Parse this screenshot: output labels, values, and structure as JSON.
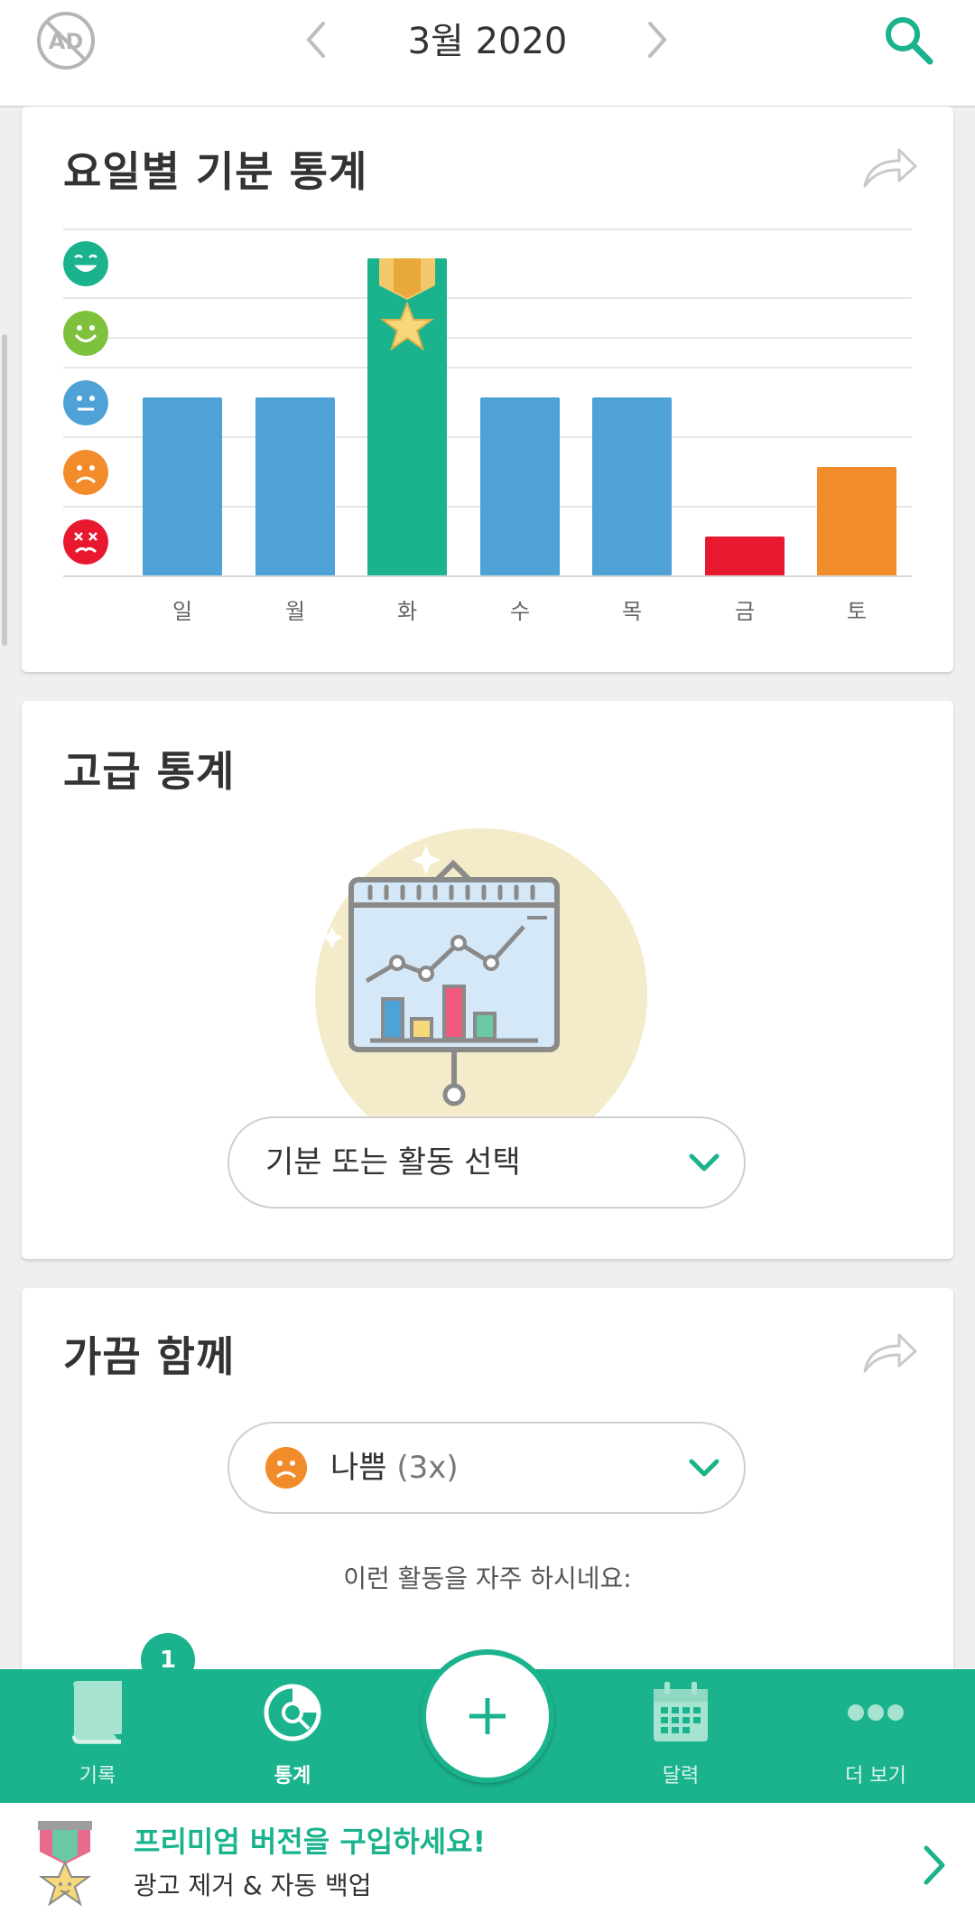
{
  "header": {
    "month_label": "3월 2020",
    "ad_icon": "ad-blocked-icon",
    "search_icon": "search-icon"
  },
  "weekday_card": {
    "title": "요일별 기분 통계",
    "share_icon": "share-icon"
  },
  "chart_data": {
    "type": "bar",
    "categories": [
      "일",
      "월",
      "화",
      "수",
      "목",
      "금",
      "토"
    ],
    "values": [
      3,
      3,
      5,
      3,
      3,
      1,
      2
    ],
    "mood_levels": [
      "rad",
      "good",
      "meh",
      "bad",
      "awful"
    ],
    "mood_colors": {
      "5": "#1ab38d",
      "4": "#7ec13c",
      "3": "#4ea2d6",
      "2": "#f28c2a",
      "1": "#e8192f"
    },
    "ylim": [
      0,
      5
    ],
    "best_day": "화"
  },
  "advanced_card": {
    "title": "고급 통계",
    "select_label": "기분 또는 활동 선택"
  },
  "often_card": {
    "title": "가끔 함께",
    "select_mood_name": "나쁨",
    "select_mood_count": "(3x)",
    "hint": "이런 활동을 자주 하시네요:",
    "badge_count": "1"
  },
  "bottom_nav": {
    "items": [
      {
        "label": "기록",
        "icon": "book-icon"
      },
      {
        "label": "통계",
        "icon": "stats-icon",
        "active": true
      },
      {
        "label": "달력",
        "icon": "calendar-icon"
      },
      {
        "label": "더 보기",
        "icon": "more-icon"
      }
    ],
    "fab_icon": "plus-icon"
  },
  "premium": {
    "title": "프리미엄 버전을 구입하세요!",
    "subtitle": "광고 제거 & 자동 백업"
  },
  "colors": {
    "accent": "#1ab38d",
    "blue": "#4ea2d6",
    "orange": "#f28c2a",
    "red": "#e8192f"
  }
}
